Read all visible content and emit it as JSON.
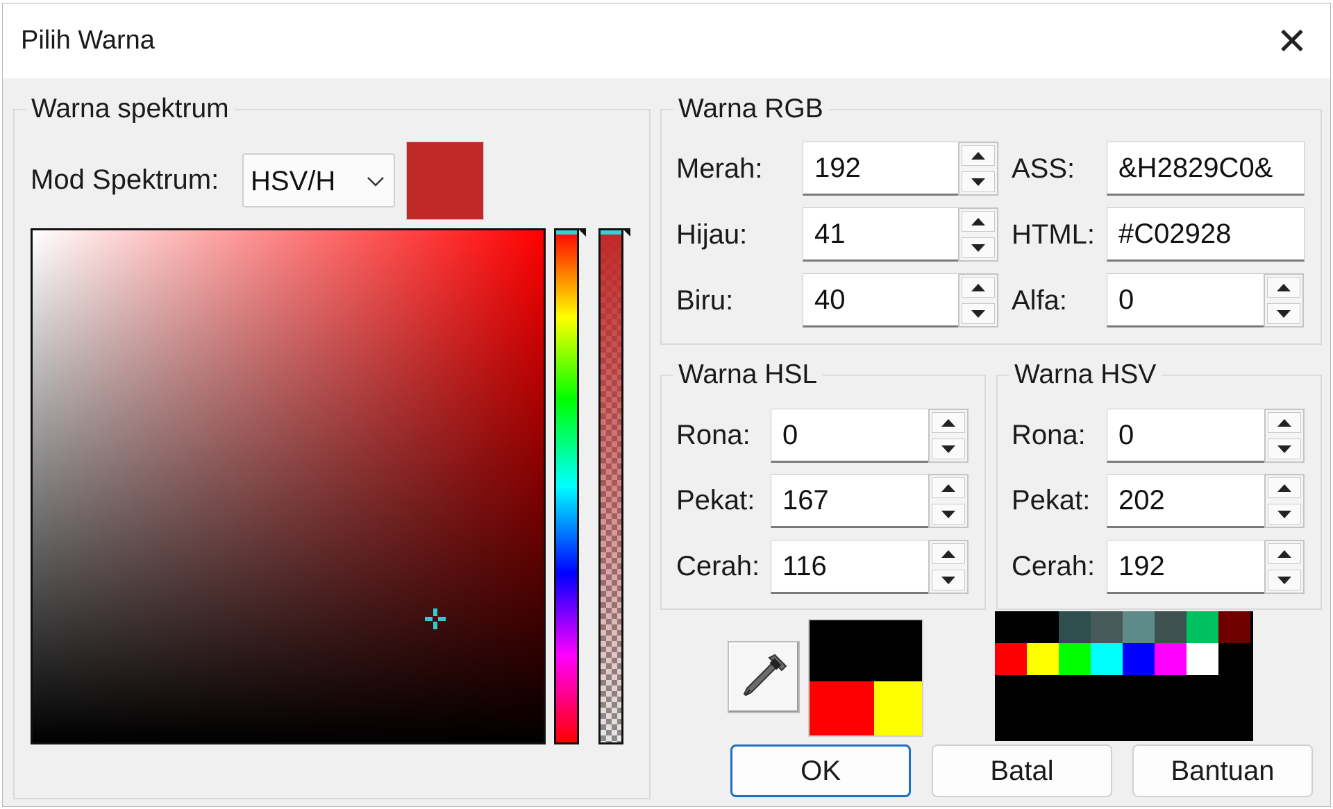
{
  "window": {
    "title": "Pilih Warna"
  },
  "spectrum": {
    "group_label": "Warna spektrum",
    "mode_label": "Mod Spektrum:",
    "mode_value": "HSV/H",
    "current_color": "#C02928"
  },
  "rgb": {
    "group_label": "Warna RGB",
    "red_label": "Merah:",
    "red": "192",
    "green_label": "Hijau:",
    "green": "41",
    "blue_label": "Biru:",
    "blue": "40",
    "ass_label": "ASS:",
    "ass": "&H2829C0&",
    "html_label": "HTML:",
    "html": "#C02928",
    "alpha_label": "Alfa:",
    "alpha": "0"
  },
  "hsl": {
    "group_label": "Warna HSL",
    "hue_label": "Rona:",
    "hue": "0",
    "sat_label": "Pekat:",
    "sat": "167",
    "light_label": "Cerah:",
    "light": "116"
  },
  "hsv": {
    "group_label": "Warna HSV",
    "hue_label": "Rona:",
    "hue": "0",
    "sat_label": "Pekat:",
    "sat": "202",
    "val_label": "Cerah:",
    "val": "192"
  },
  "recent": {
    "top": "#000000",
    "bottom_left": "#FF0000",
    "bottom_right": "#FFFF00"
  },
  "palette": {
    "row1": [
      "#000000",
      "#000000",
      "#2F4F4F",
      "#465A5A",
      "#5F8A8A",
      "#3F5050",
      "#00C060",
      "#700000"
    ],
    "row2": [
      "#FF0000",
      "#FFFF00",
      "#00FF00",
      "#00FFFF",
      "#0000FF",
      "#FF00FF",
      "#FFFFFF",
      "#000000"
    ]
  },
  "buttons": {
    "ok": "OK",
    "cancel": "Batal",
    "help": "Bantuan"
  }
}
